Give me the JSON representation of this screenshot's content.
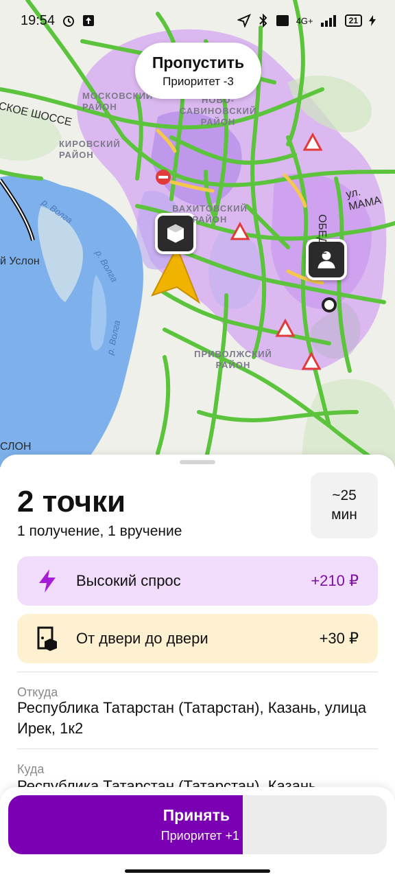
{
  "statusbar": {
    "time": "19:54",
    "network": "4G+",
    "battery": "21"
  },
  "map": {
    "skip": {
      "title": "Пропустить",
      "subtitle": "Приоритет -3"
    },
    "labels": {
      "moscow_district": "Московский район",
      "kirov_district": "Кировский район",
      "savinovo_district": "Ново-Савиновский район",
      "vakhitov_district": "Вахитовский район",
      "privolzhsky_district": "Приволжский район",
      "highway": "СКОЕ ШОССЕ",
      "street": "ул. МАМА",
      "pobedy": "ОБЕДЫ",
      "uslon": "й Услон",
      "slon": "СЛОН",
      "volga1": "р. Волга",
      "volga2": "р. Волга",
      "volga3": "р. Волга"
    }
  },
  "order": {
    "title": "2 точки",
    "subtitle": "1 получение, 1 вручение",
    "eta_value": "~25",
    "eta_unit": "мин",
    "demand": {
      "label": "Высокий спрос",
      "value": "+210 ₽",
      "icon": "lightning-icon"
    },
    "door": {
      "label": "От двери до двери",
      "value": "+30 ₽",
      "icon": "door-box-icon"
    },
    "from": {
      "label": "Откуда",
      "address": "Республика Татарстан (Татарстан), Казань, улица Ирек, 1к2"
    },
    "to": {
      "label": "Куда",
      "address": "Республика Татарстан (Татарстан), Казань,"
    }
  },
  "accept": {
    "title": "Принять",
    "subtitle": "Приоритет +1",
    "progress": 0.62
  },
  "colors": {
    "accent": "#7b00b4",
    "traffic_green": "#5bc43c",
    "demand_bg": "#f2dcfb",
    "door_bg": "#fdf1d2"
  }
}
